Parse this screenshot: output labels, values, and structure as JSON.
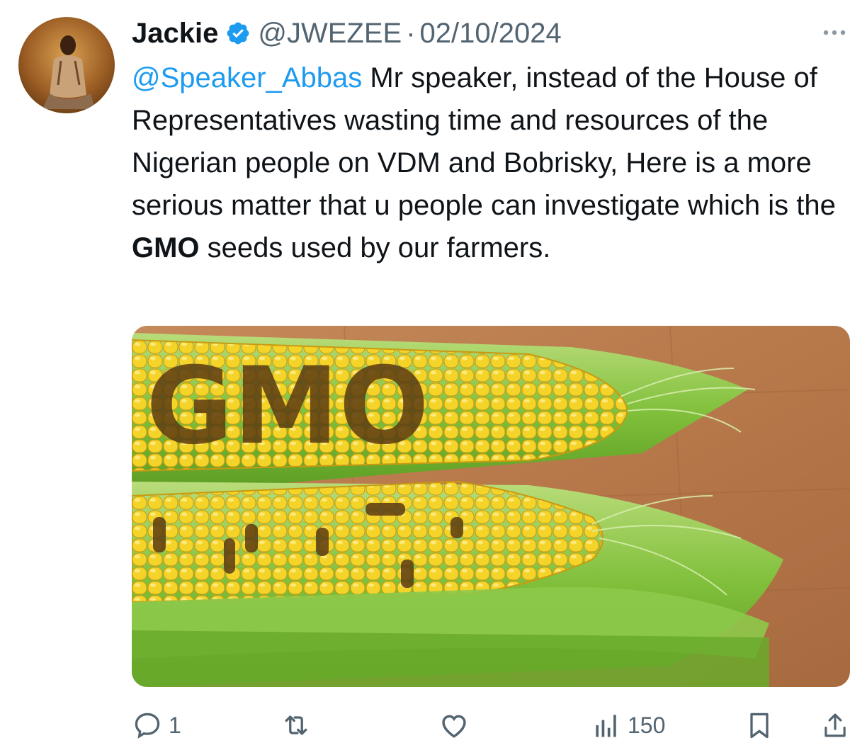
{
  "author": {
    "name": "Jackie",
    "handle": "@JWEZEE",
    "separator": "·",
    "date": "02/10/2024",
    "verified": true,
    "avatar_icon": "avatar-photo"
  },
  "tweet": {
    "mention": "@Speaker_Abbas",
    "text_before_bold": " Mr speaker, instead of the House of Representatives wasting time and resources of the Nigerian people on VDM and Bobrisky, Here is a more serious matter that u people can investigate which is the ",
    "bold_word": "GMO",
    "text_after_bold": " seeds used by our farmers."
  },
  "media": {
    "icon": "corn-photo",
    "stamped_text": "GMO"
  },
  "actions": {
    "reply_count": "1",
    "retweet_count": "",
    "like_count": "",
    "views_count": "150"
  },
  "colors": {
    "accent": "#1d9bf0",
    "text": "#0f1419",
    "muted": "#536471"
  }
}
